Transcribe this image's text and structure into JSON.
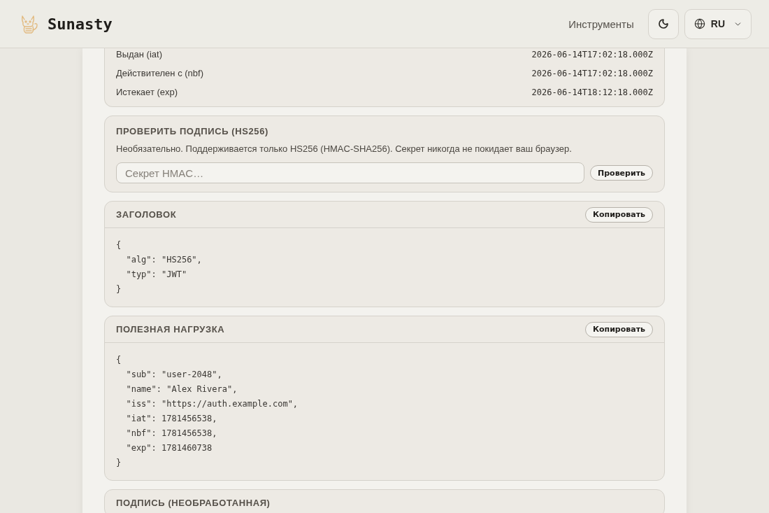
{
  "header": {
    "logo": "Sunasty",
    "nav_link": "Инструменты",
    "language": "RU"
  },
  "claims": [
    {
      "label": "Выдан (iat)",
      "value": "2026-06-14T17:02:18.000Z"
    },
    {
      "label": "Действителен с (nbf)",
      "value": "2026-06-14T17:02:18.000Z"
    },
    {
      "label": "Истекает (exp)",
      "value": "2026-06-14T18:12:18.000Z"
    }
  ],
  "verify": {
    "title": "ПРОВЕРИТЬ ПОДПИСЬ (HS256)",
    "description": "Необязательно. Поддерживается только HS256 (HMAC-SHA256). Секрет никогда не покидает ваш браузер.",
    "secret_placeholder": "Секрет HMAC…",
    "button": "Проверить"
  },
  "sections": [
    {
      "title": "ЗАГОЛОВОК",
      "copy_button": "Копировать",
      "code": [
        "{",
        "  \"alg\": \"HS256\",",
        "  \"typ\": \"JWT\"",
        "}"
      ]
    },
    {
      "title": "ПОЛЕЗНАЯ НАГРУЗКА",
      "copy_button": "Копировать",
      "code": [
        "{",
        "  \"sub\": \"user-2048\",",
        "  \"name\": \"Alex Rivera\",",
        "  \"iss\": \"https://auth.example.com\",",
        "  \"iat\": 1781456538,",
        "  \"nbf\": 1781456538,",
        "  \"exp\": 1781460738",
        "}"
      ]
    },
    {
      "title": "ПОДПИСЬ (НЕОБРАБОТАННАЯ)"
    }
  ]
}
